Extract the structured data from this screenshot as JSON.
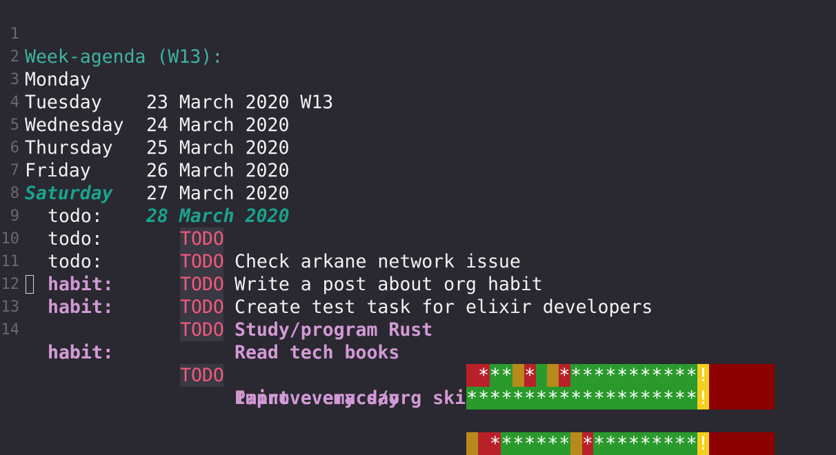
{
  "colors": {
    "background": "#2a2830",
    "header": "#3fb3a1",
    "today": "#1aa38d",
    "todo_keyword": "#f05a7e",
    "habit_text": "#d29ad6",
    "habit_red": "#b8212a",
    "habit_orange": "#b88a1c",
    "habit_green": "#2a9a2c",
    "habit_today": "#f5cf1e",
    "habit_future": "#8c0000"
  },
  "agenda": {
    "title": "Week-agenda (W13):",
    "days": [
      {
        "num": "2",
        "name": "Monday",
        "date": "23 March 2020 W13"
      },
      {
        "num": "3",
        "name": "Tuesday",
        "date": "24 March 2020"
      },
      {
        "num": "4",
        "name": "Wednesday",
        "date": "25 March 2020"
      },
      {
        "num": "5",
        "name": "Thursday",
        "date": "26 March 2020"
      },
      {
        "num": "6",
        "name": "Friday",
        "date": "27 March 2020"
      },
      {
        "num": "7",
        "name": "Saturday",
        "date": "28 March 2020"
      }
    ],
    "title_num": "1",
    "todo_keyword": "TODO",
    "entries": [
      {
        "num": "8",
        "category": "todo:",
        "task": "Check arkane network issue"
      },
      {
        "num": "9",
        "category": "todo:",
        "task": "Write a post about org habit"
      },
      {
        "num": "10",
        "category": "todo:",
        "task": "Create test task for elixir developers"
      },
      {
        "num": "11",
        "category": "habit:",
        "task": "Study/program Rust"
      },
      {
        "num": "12",
        "category": "habit:",
        "task": "Read tech books"
      },
      {
        "num": "13",
        "category": "habit:",
        "task": "Improve emacs/org ski"
      },
      {
        "num": "14",
        "category": "habit:",
        "task": "Paint every day"
      }
    ]
  },
  "habit_graphs": [
    {
      "cells": [
        [
          "r",
          ""
        ],
        [
          "r",
          "*"
        ],
        [
          "g",
          "*"
        ],
        [
          "g",
          "*"
        ],
        [
          "o",
          ""
        ],
        [
          "r",
          "*"
        ],
        [
          "g",
          ""
        ],
        [
          "o",
          ""
        ],
        [
          "r",
          "*"
        ],
        [
          "g",
          "*"
        ],
        [
          "g",
          "*"
        ],
        [
          "g",
          "*"
        ],
        [
          "g",
          "*"
        ],
        [
          "g",
          "*"
        ],
        [
          "g",
          "*"
        ],
        [
          "g",
          "*"
        ],
        [
          "g",
          "*"
        ],
        [
          "g",
          "*"
        ],
        [
          "g",
          "*"
        ],
        [
          "g",
          "*"
        ],
        [
          "y",
          "!"
        ]
      ]
    },
    {
      "cells": [
        [
          "g",
          "*"
        ],
        [
          "g",
          "*"
        ],
        [
          "g",
          "*"
        ],
        [
          "g",
          "*"
        ],
        [
          "g",
          "*"
        ],
        [
          "g",
          "*"
        ],
        [
          "g",
          "*"
        ],
        [
          "g",
          "*"
        ],
        [
          "g",
          "*"
        ],
        [
          "g",
          "*"
        ],
        [
          "g",
          "*"
        ],
        [
          "g",
          "*"
        ],
        [
          "g",
          "*"
        ],
        [
          "g",
          "*"
        ],
        [
          "g",
          "*"
        ],
        [
          "g",
          "*"
        ],
        [
          "g",
          "*"
        ],
        [
          "g",
          "*"
        ],
        [
          "g",
          "*"
        ],
        [
          "g",
          "*"
        ],
        [
          "y",
          "!"
        ]
      ]
    },
    {
      "cells": [
        [
          "g",
          "*"
        ],
        [
          "g",
          "*"
        ],
        [
          "g",
          "*"
        ],
        [
          "g",
          "*"
        ],
        [
          "g",
          "*"
        ],
        [
          "g",
          "*"
        ],
        [
          "g",
          "*"
        ],
        [
          "g",
          "*"
        ],
        [
          "g",
          "*"
        ],
        [
          "g",
          "*"
        ],
        [
          "g",
          "*"
        ],
        [
          "g",
          "*"
        ],
        [
          "g",
          "*"
        ],
        [
          "g",
          "*"
        ],
        [
          "g",
          "*"
        ],
        [
          "g",
          "*"
        ],
        [
          "g",
          "*"
        ],
        [
          "g",
          "*"
        ],
        [
          "g",
          "*"
        ],
        [
          "g",
          "*"
        ],
        [
          "y",
          "!"
        ]
      ]
    },
    {
      "cells": [
        [
          "o",
          ""
        ],
        [
          "r",
          ""
        ],
        [
          "r",
          "*"
        ],
        [
          "g",
          "*"
        ],
        [
          "g",
          "*"
        ],
        [
          "g",
          "*"
        ],
        [
          "g",
          "*"
        ],
        [
          "g",
          "*"
        ],
        [
          "g",
          "*"
        ],
        [
          "o",
          ""
        ],
        [
          "r",
          "*"
        ],
        [
          "g",
          "*"
        ],
        [
          "g",
          "*"
        ],
        [
          "g",
          "*"
        ],
        [
          "g",
          "*"
        ],
        [
          "g",
          "*"
        ],
        [
          "g",
          "*"
        ],
        [
          "g",
          "*"
        ],
        [
          "g",
          "*"
        ],
        [
          "g",
          "*"
        ],
        [
          "y",
          "!"
        ]
      ]
    }
  ]
}
